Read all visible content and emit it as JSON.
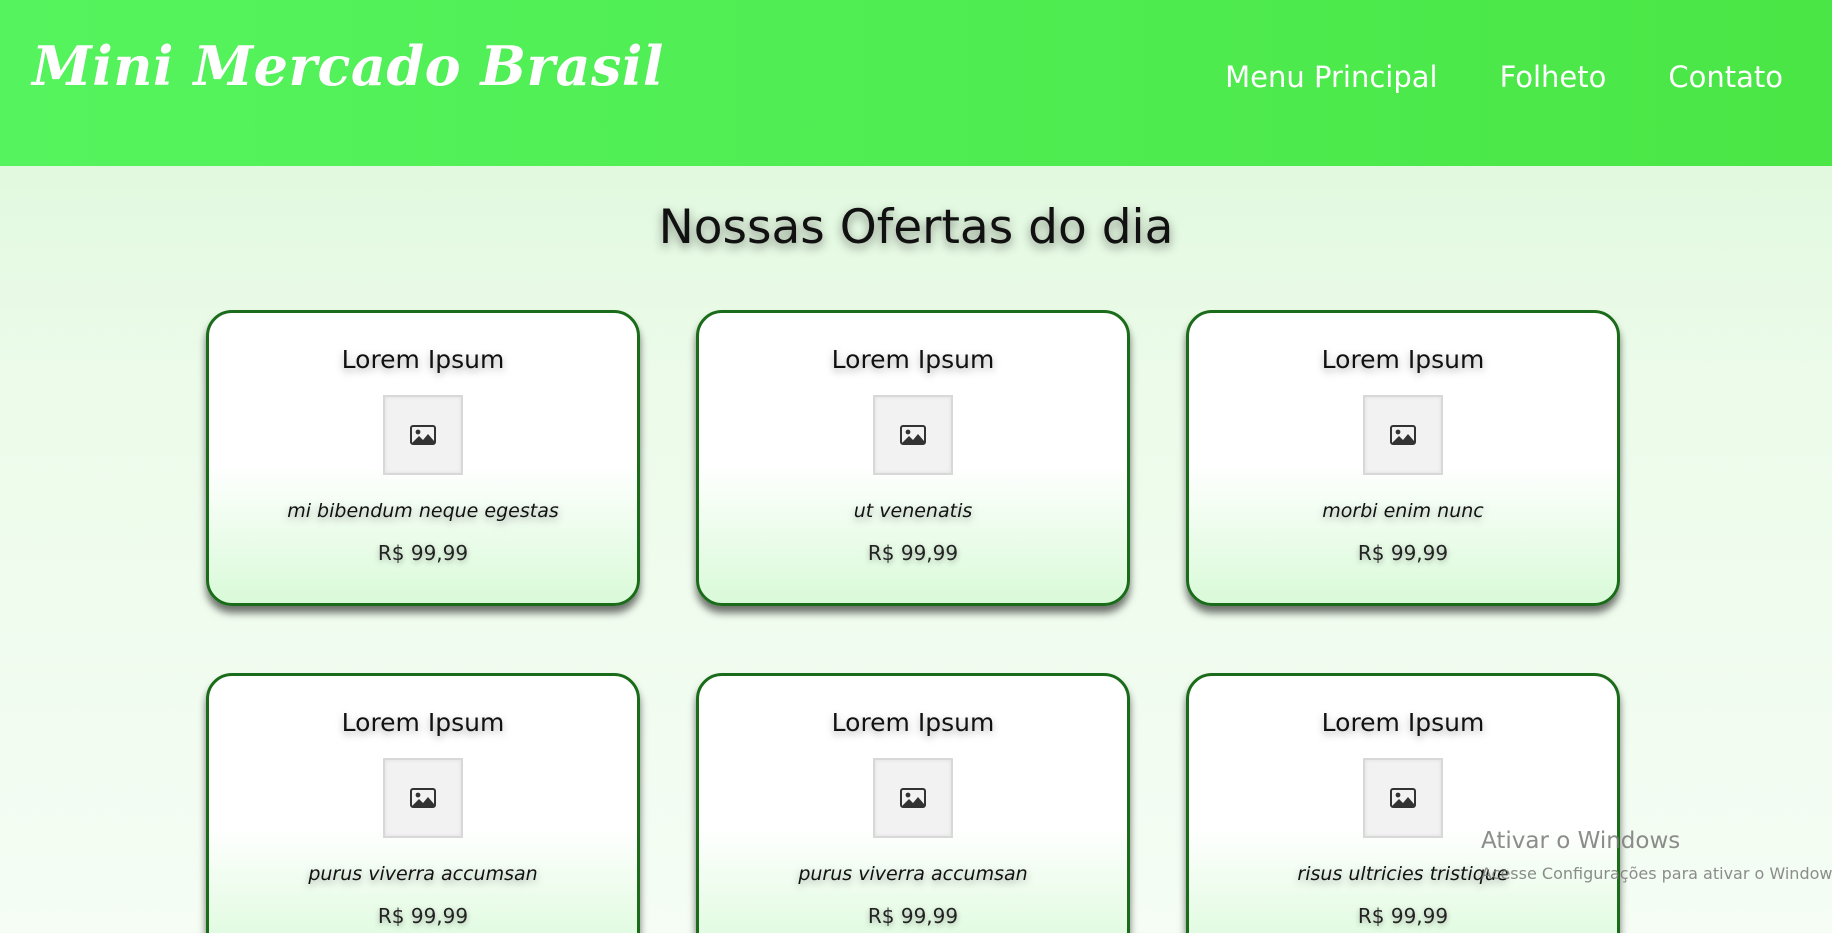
{
  "header": {
    "brand": "Mini Mercado Brasil",
    "nav": [
      {
        "label": "Menu Principal"
      },
      {
        "label": "Folheto"
      },
      {
        "label": "Contato"
      }
    ],
    "colors": {
      "start": "#55f45e",
      "end": "#4ae646"
    }
  },
  "main": {
    "title": "Nossas Ofertas do dia",
    "cards": [
      {
        "title": "Lorem Ipsum",
        "image_icon": "image-icon",
        "desc": "mi bibendum neque egestas",
        "price": "R$ 99,99"
      },
      {
        "title": "Lorem Ipsum",
        "image_icon": "image-icon",
        "desc": "ut venenatis",
        "price": "R$ 99,99"
      },
      {
        "title": "Lorem Ipsum",
        "image_icon": "image-icon",
        "desc": "morbi enim nunc",
        "price": "R$ 99,99"
      },
      {
        "title": "Lorem Ipsum",
        "image_icon": "image-icon",
        "desc": "purus viverra accumsan",
        "price": "R$ 99,99"
      },
      {
        "title": "Lorem Ipsum",
        "image_icon": "image-icon",
        "desc": "purus viverra accumsan",
        "price": "R$ 99,99"
      },
      {
        "title": "Lorem Ipsum",
        "image_icon": "image-icon",
        "desc": "risus ultricies tristique",
        "price": "R$ 99,99"
      }
    ],
    "card_border_color": "#1a6b1a"
  },
  "watermark": {
    "title": "Ativar o Windows",
    "subtitle": "Acesse Configurações para ativar o Windows."
  }
}
